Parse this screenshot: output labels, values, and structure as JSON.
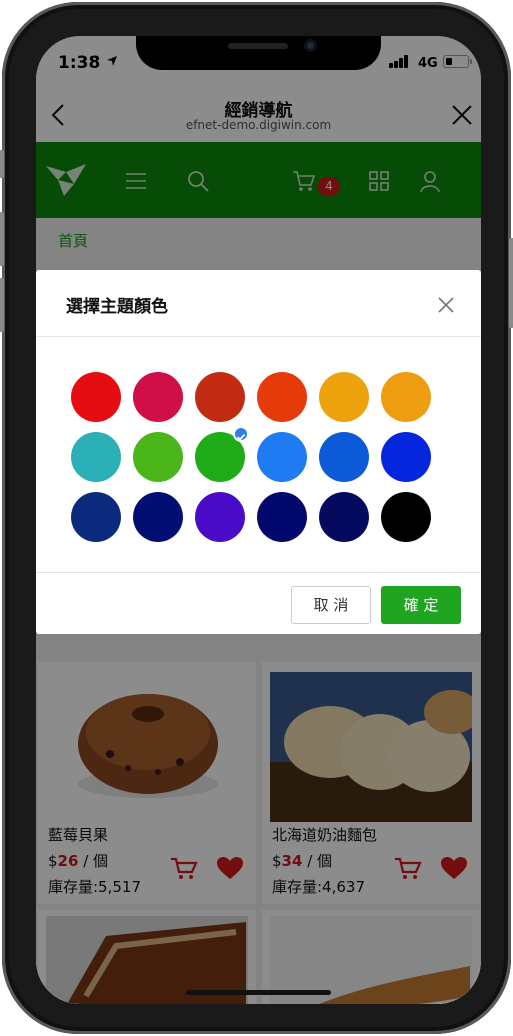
{
  "status_bar": {
    "time": "1:38",
    "network": "4G"
  },
  "browser_header": {
    "title": "經銷導航",
    "url": "efnet-demo.digiwin.com"
  },
  "navbar": {
    "cart_count": "4",
    "brand_color": "#0c8a0c"
  },
  "breadcrumb": {
    "home": "首頁"
  },
  "modal": {
    "title": "選擇主題顏色",
    "cancel_label": "取 消",
    "confirm_label": "確 定",
    "selected_index": 8,
    "swatches": [
      "#e50d12",
      "#d00e48",
      "#c22a12",
      "#e53b0a",
      "#eea20e",
      "#ee9c10",
      "#2cb0b8",
      "#4ab61a",
      "#20ac18",
      "#1f7bf2",
      "#0c5ad8",
      "#0525de",
      "#0b2a7d",
      "#030e72",
      "#4a0bc8",
      "#03086d",
      "#050a5e",
      "#000000"
    ]
  },
  "products": [
    {
      "name": "藍莓貝果",
      "price_currency": "$",
      "price_value": "26",
      "price_unit": " / 個",
      "stock": "庫存量:5,517"
    },
    {
      "name": "北海道奶油麵包",
      "price_currency": "$",
      "price_value": "34",
      "price_unit": " / 個",
      "stock": "庫存量:4,637"
    }
  ]
}
